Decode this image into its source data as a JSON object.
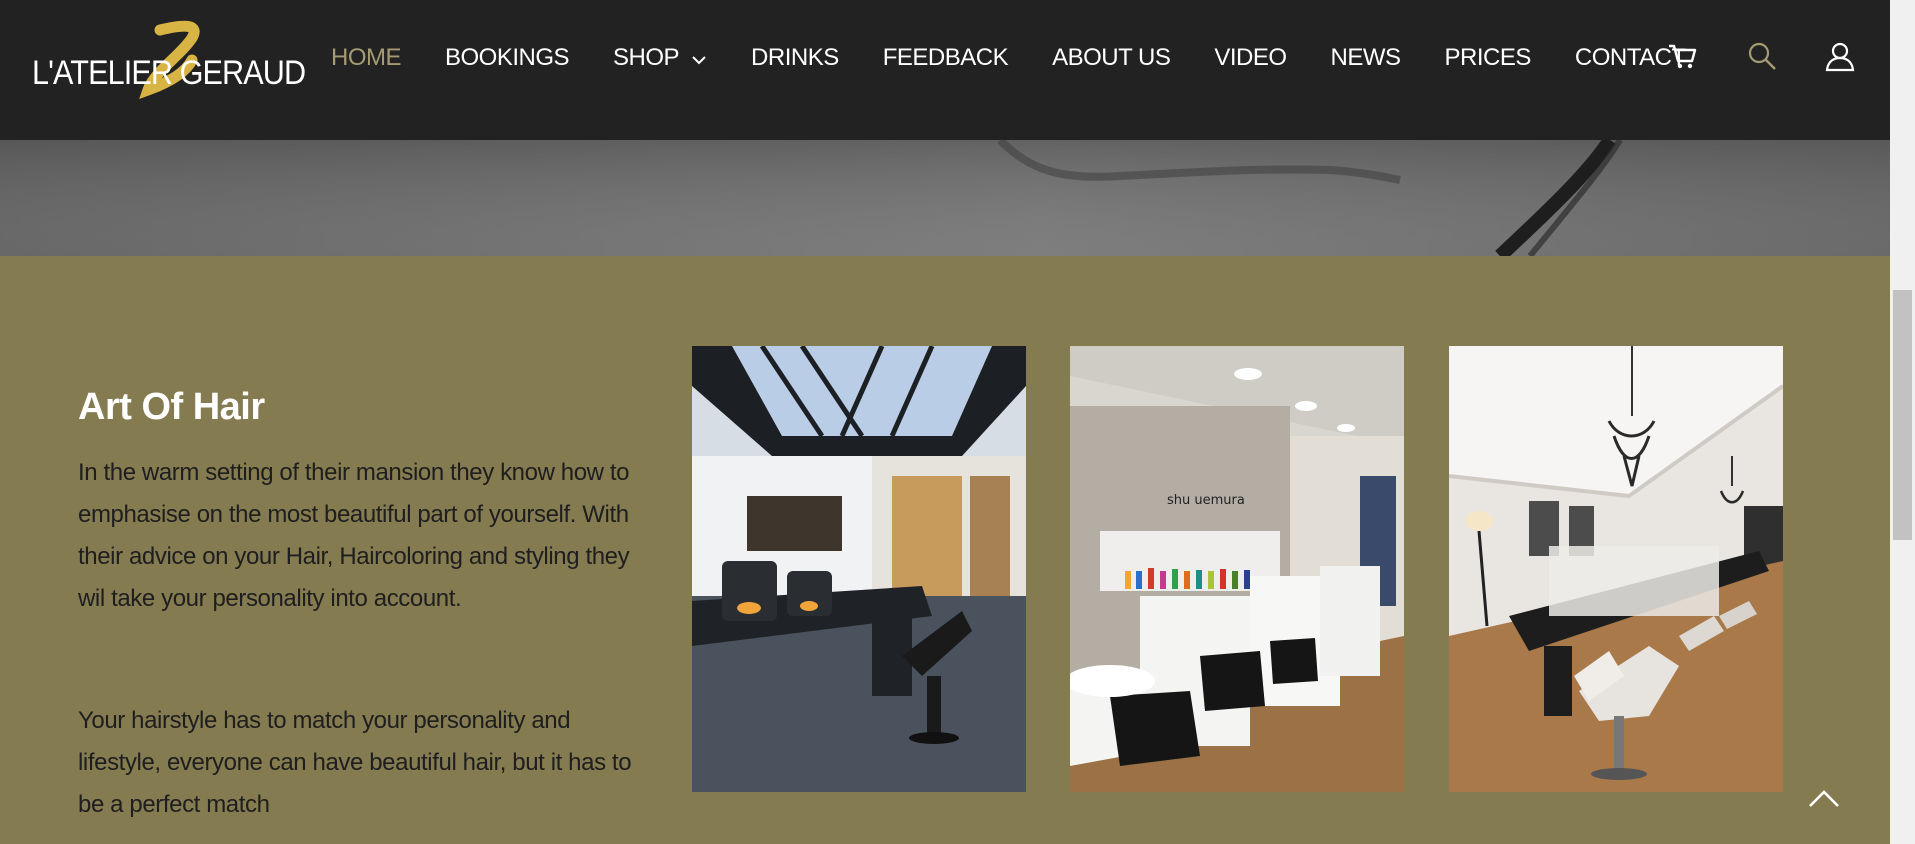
{
  "brand": {
    "logo_text": "L'ATELIER GERAUD",
    "accent": "#d8b445"
  },
  "nav": {
    "items": [
      {
        "label": "HOME",
        "active": true
      },
      {
        "label": "BOOKINGS"
      },
      {
        "label": "SHOP",
        "has_dropdown": true
      },
      {
        "label": "DRINKS"
      },
      {
        "label": "FEEDBACK"
      },
      {
        "label": "ABOUT US"
      },
      {
        "label": "VIDEO"
      },
      {
        "label": "NEWS"
      },
      {
        "label": "PRICES"
      },
      {
        "label": "CONTACT"
      }
    ],
    "icons": [
      "cart-icon",
      "search-icon",
      "user-icon"
    ]
  },
  "section": {
    "title": "Art Of Hair",
    "paragraph1": "In the warm setting of their mansion they know how to emphasise on the most beautiful part of yourself. With their advice on your Hair, Haircoloring and styling they wil take your personality into account.",
    "paragraph2": "Your hairstyle has to match your personality and lifestyle, everyone can have beautiful hair, but it has to be a perfect match",
    "photos": [
      {
        "name": "photo-salon-skylight"
      },
      {
        "name": "photo-salon-washbasins",
        "sign": "shu uemura"
      },
      {
        "name": "photo-salon-chandelier"
      }
    ]
  },
  "colors": {
    "header_bg": "#222222",
    "section_bg": "#857b51",
    "active_nav": "#a59b72"
  }
}
